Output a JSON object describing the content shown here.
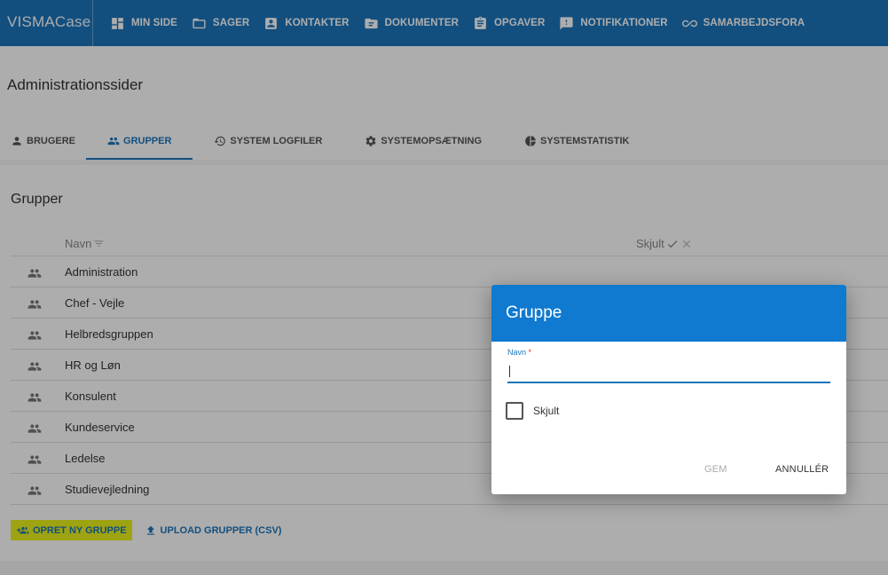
{
  "app": {
    "logo_brand": "VISMA",
    "logo_product": "Case"
  },
  "nav": [
    {
      "label": "MIN SIDE",
      "icon": "dashboard-icon"
    },
    {
      "label": "SAGER",
      "icon": "folder-icon"
    },
    {
      "label": "KONTAKTER",
      "icon": "contact-card-icon"
    },
    {
      "label": "DOKUMENTER",
      "icon": "document-folder-icon"
    },
    {
      "label": "OPGAVER",
      "icon": "clipboard-icon"
    },
    {
      "label": "NOTIFIKATIONER",
      "icon": "alert-message-icon"
    },
    {
      "label": "SAMARBEJDSFORA",
      "icon": "infinity-icon"
    }
  ],
  "page": {
    "title": "Administrationssider"
  },
  "tabs": [
    {
      "label": "BRUGERE",
      "icon": "person-icon"
    },
    {
      "label": "GRUPPER",
      "icon": "group-icon",
      "active": true
    },
    {
      "label": "SYSTEM LOGFILER",
      "icon": "history-icon"
    },
    {
      "label": "SYSTEMOPSÆTNING",
      "icon": "gear-icon"
    },
    {
      "label": "SYSTEMSTATISTIK",
      "icon": "pie-chart-icon"
    }
  ],
  "groups": {
    "title": "Grupper",
    "columns": {
      "name": "Navn",
      "hidden": "Skjult"
    },
    "rows": [
      "Administration",
      "Chef - Vejle",
      "Helbredsgruppen",
      "HR og Løn",
      "Konsulent",
      "Kundeservice",
      "Ledelse",
      "Studievejledning"
    ],
    "create_label": "OPRET NY GRUPPE",
    "upload_label": "UPLOAD GRUPPER (CSV)"
  },
  "dialog": {
    "title": "Gruppe",
    "name_label": "Navn",
    "required_mark": "*",
    "name_value": "",
    "hidden_label": "Skjult",
    "save_label": "GEM",
    "cancel_label": "ANNULLÉR"
  },
  "colors": {
    "brand_blue": "#1b75bb",
    "dialog_header": "#0f7ad0",
    "highlight": "#e9f11a"
  }
}
